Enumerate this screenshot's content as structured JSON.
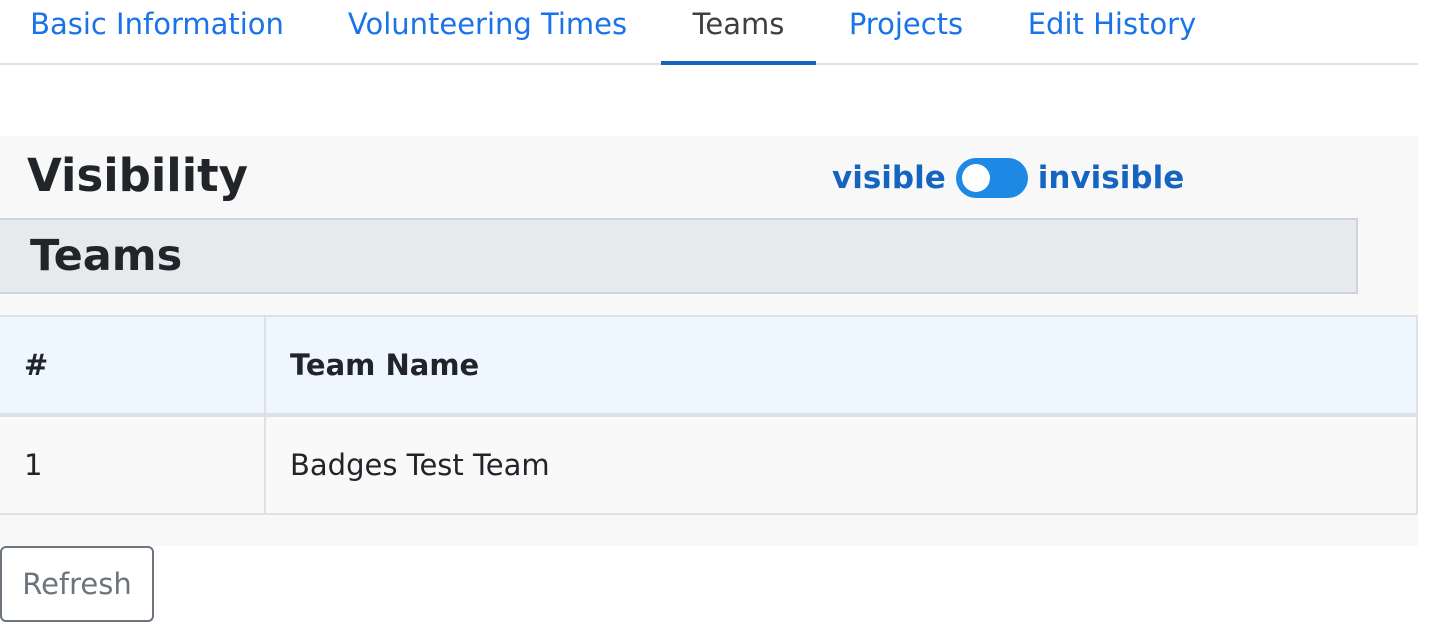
{
  "tabs": [
    {
      "label": "Basic Information",
      "active": false
    },
    {
      "label": "Volunteering Times",
      "active": false
    },
    {
      "label": "Teams",
      "active": true
    },
    {
      "label": "Projects",
      "active": false
    },
    {
      "label": "Edit History",
      "active": false
    }
  ],
  "visibility": {
    "title": "Visibility",
    "left_label": "visible",
    "right_label": "invisible",
    "toggle_state": "visible"
  },
  "teams_section": {
    "title": "Teams",
    "columns": [
      "#",
      "Team Name"
    ],
    "rows": [
      {
        "num": "1",
        "name": "Badges Test Team"
      }
    ]
  },
  "actions": {
    "refresh_label": "Refresh"
  },
  "colors": {
    "link": "#1a73e8",
    "active_tab_underline": "#1565c0",
    "toggle_on": "#1e88e5"
  }
}
